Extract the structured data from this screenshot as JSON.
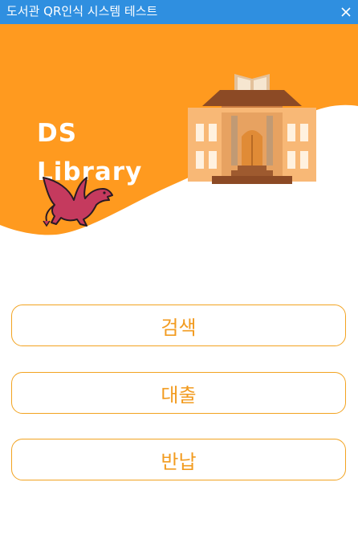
{
  "window": {
    "title": "도서관 QR인식 시스템 테스트"
  },
  "brand": {
    "line1": "DS",
    "line2": "Library"
  },
  "buttons": [
    {
      "label": "검색"
    },
    {
      "label": "대출"
    },
    {
      "label": "반납"
    }
  ],
  "colors": {
    "titlebar": "#2f8fe0",
    "accent": "#ff9a1f",
    "button_text": "#f29b1f",
    "button_border": "#f2a320"
  },
  "icons": [
    "close-icon",
    "library-building-icon",
    "dragon-logo"
  ]
}
